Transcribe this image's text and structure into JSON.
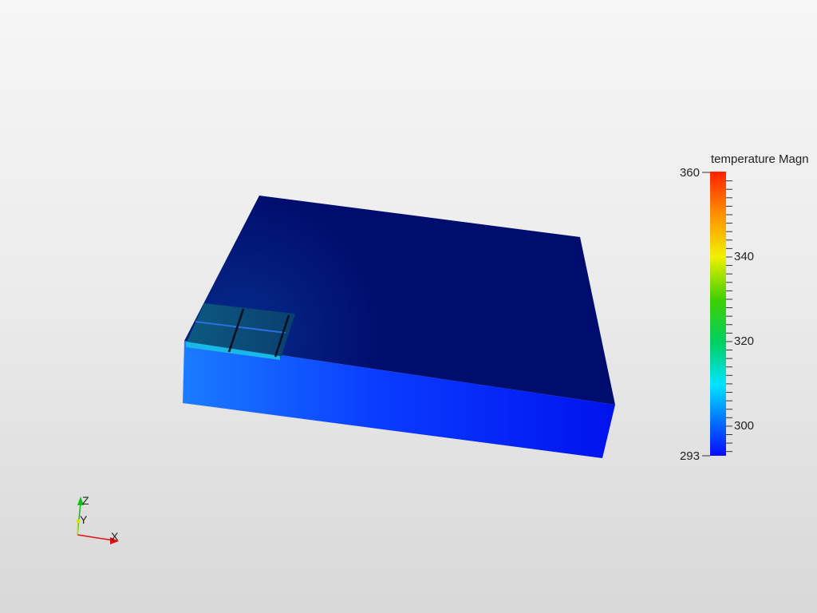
{
  "viewer": {
    "scalar_bar": {
      "title": "temperature Magn",
      "range": [
        293,
        360
      ],
      "max_label": "360",
      "min_label": "293",
      "labels": [
        "340",
        "320",
        "300"
      ],
      "label_values": [
        340,
        320,
        300
      ],
      "colormap": [
        "#0a0aff",
        "#0070ff",
        "#00e4ff",
        "#00d060",
        "#40d000",
        "#f0f000",
        "#ff9000",
        "#ff2000"
      ]
    },
    "orientation_axes": {
      "x_label": "X",
      "y_label": "Y",
      "z_label": "Z",
      "x_color": "#e01010",
      "y_color": "#e0e000",
      "z_color": "#10c010"
    },
    "model": {
      "top_color": "#000c6e",
      "side_color_left": "#1a78ff",
      "side_color_right": "#0010f0",
      "chip_color": "#0d4a78"
    }
  }
}
